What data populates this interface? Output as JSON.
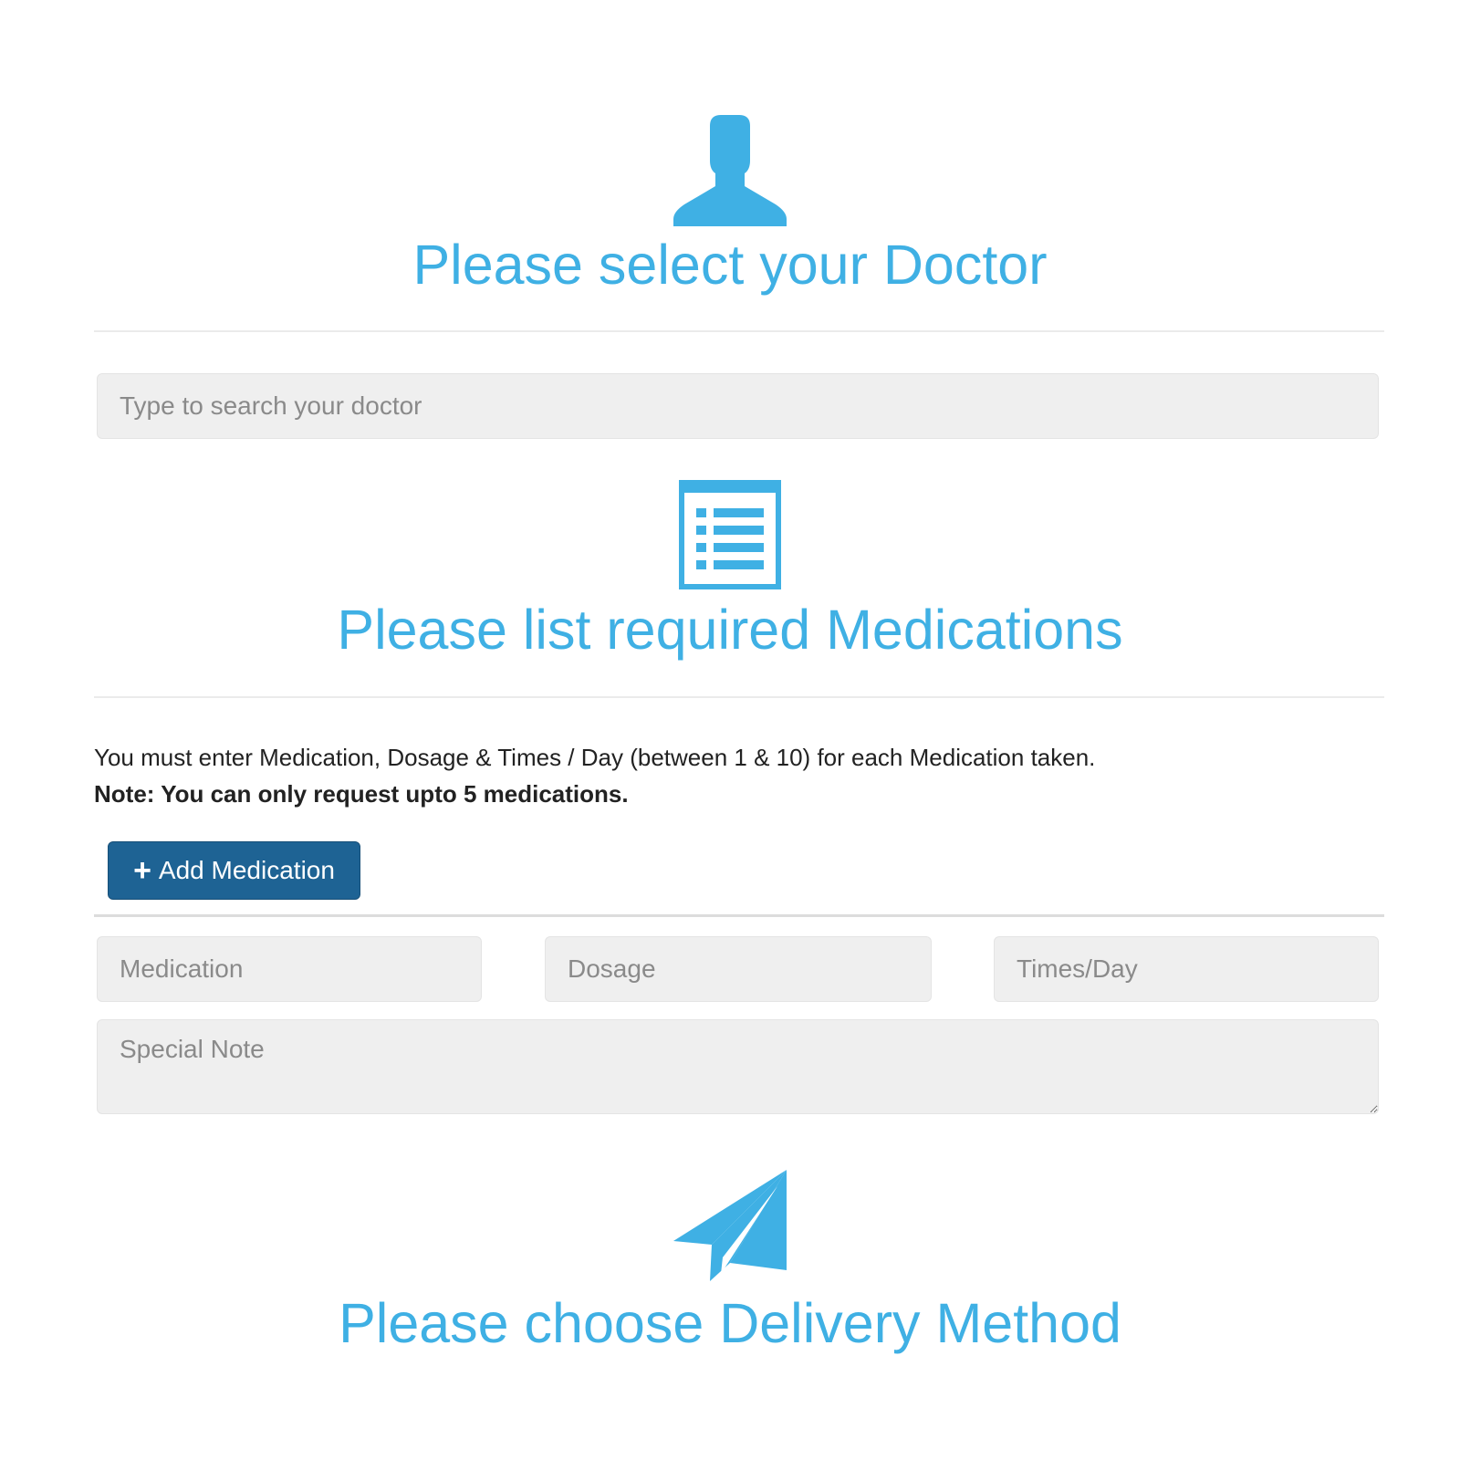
{
  "sections": {
    "doctor": {
      "icon": "user-icon",
      "title": "Please select your Doctor",
      "search_placeholder": "Type to search your doctor"
    },
    "medications": {
      "icon": "list-icon",
      "title": "Please list required Medications",
      "instruction": "You must enter Medication, Dosage & Times / Day (between 1 & 10) for each Medication taken.",
      "note": "Note: You can only request upto 5 medications.",
      "add_button_icon": "plus-icon",
      "add_button_label": "Add Medication",
      "fields": {
        "medication_placeholder": "Medication",
        "dosage_placeholder": "Dosage",
        "times_placeholder": "Times/Day",
        "special_note_placeholder": "Special Note"
      }
    },
    "delivery": {
      "icon": "paper-plane-icon",
      "title": "Please choose Delivery Method"
    }
  },
  "colors": {
    "accent": "#3fb0e4",
    "button": "#1e6394",
    "field_bg": "#efefef"
  }
}
